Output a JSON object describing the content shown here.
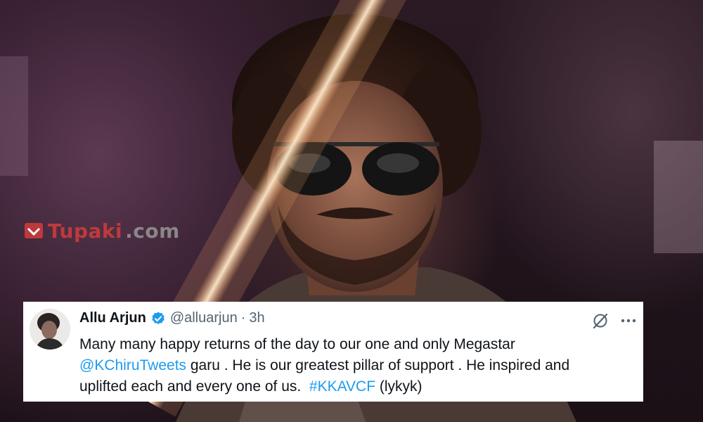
{
  "watermark": {
    "brand": "Tupaki",
    "domain": ".com"
  },
  "tweet": {
    "author_name": "Allu Arjun",
    "handle": "@alluarjun",
    "separator": "·",
    "time": "3h",
    "body": {
      "line1": "Many many happy returns of the day to our one and only Megastar",
      "mention": "@KChiruTweets",
      "line2_rest": " garu . He is our greatest pillar of support . He inspired and",
      "line3_start": "uplifted each and every one of us.  ",
      "hashtag": "#KKAVCF",
      "line3_end": " (lykyk)"
    },
    "icons": [
      "avatar",
      "verified-badge-icon",
      "grok-icon",
      "more-icon"
    ],
    "colors": {
      "link": "#1d9bf0",
      "verified": "#1d9bf0",
      "secondary_text": "#536471"
    }
  }
}
